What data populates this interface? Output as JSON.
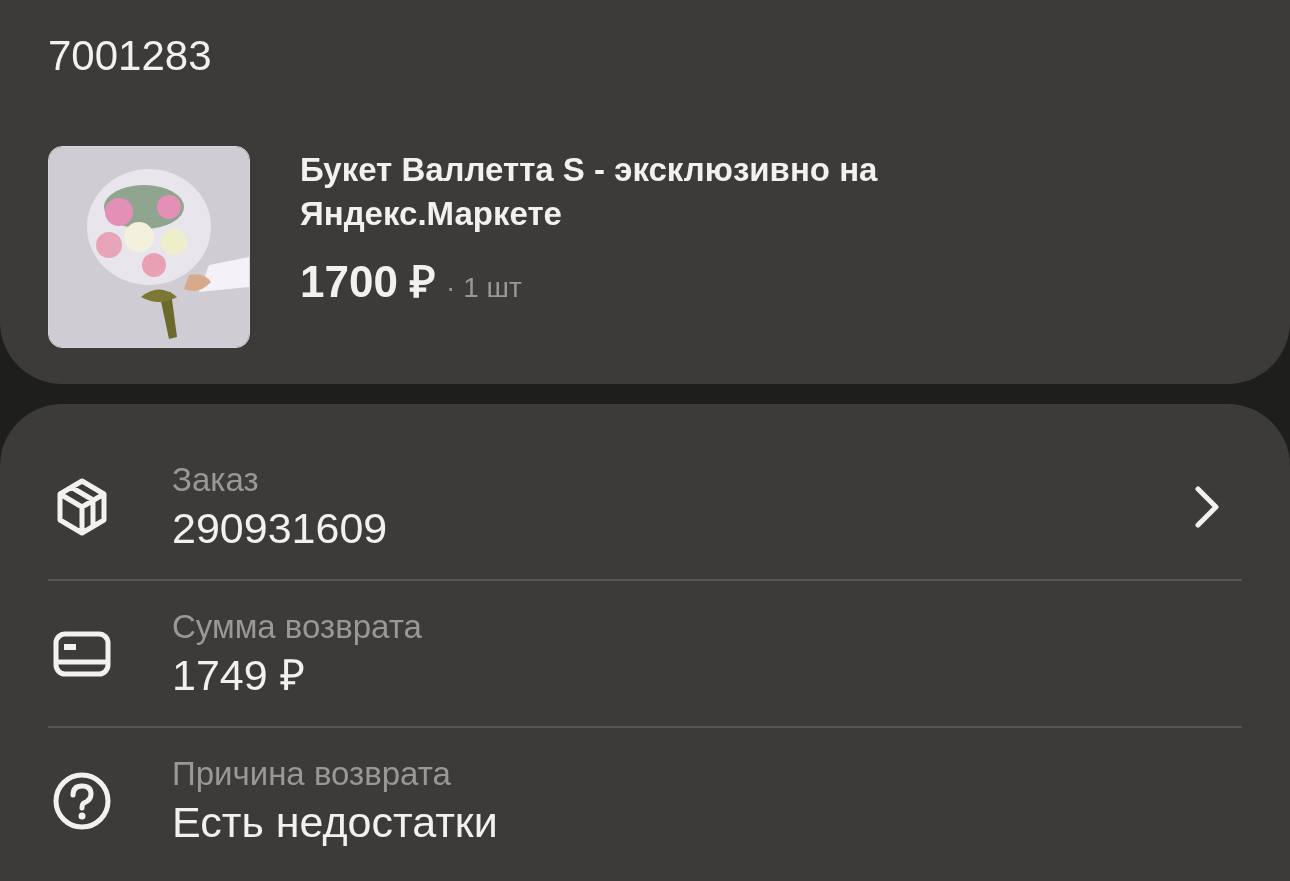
{
  "product_card": {
    "code": "7001283",
    "product": {
      "title": "Букет Валлетта S - эксклюзивно на Яндекс.Маркете",
      "price": "1700 ₽",
      "quantity": "· 1 шт"
    }
  },
  "details": [
    {
      "kind": "box",
      "label": "Заказ",
      "value": "290931609",
      "link": true
    },
    {
      "kind": "card",
      "label": "Сумма возврата",
      "value": "1749 ₽",
      "link": false
    },
    {
      "kind": "question",
      "label": "Причина возврата",
      "value": "Есть недостатки",
      "link": false
    }
  ]
}
